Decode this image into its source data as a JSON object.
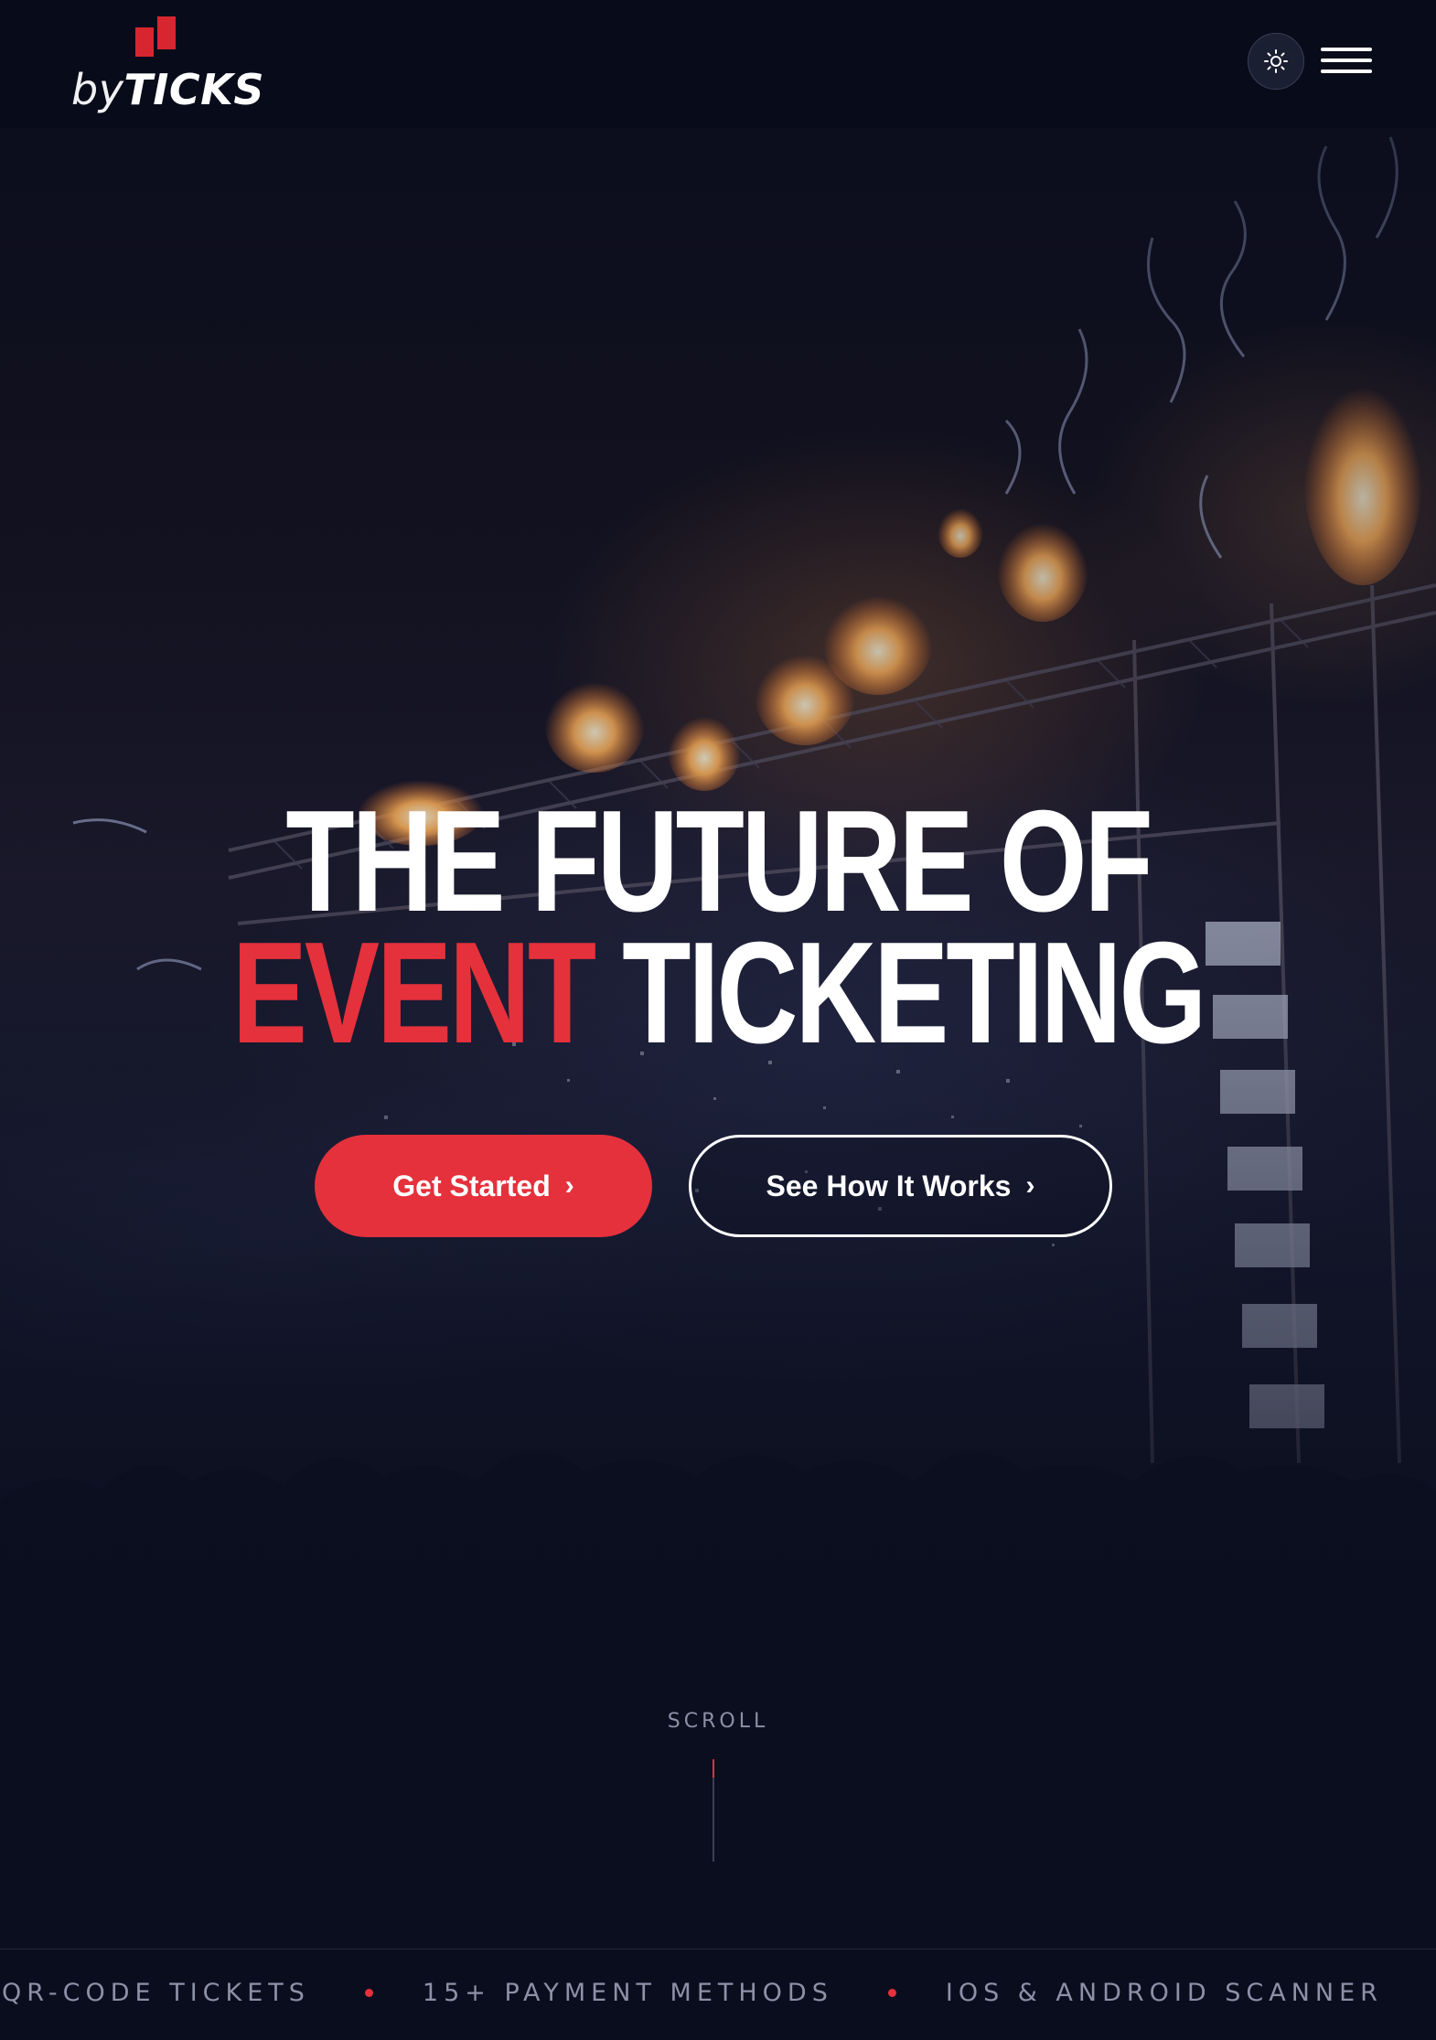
{
  "brand": {
    "logo_by": "by",
    "logo_ticks": "TICKS",
    "accent_color": "#e5313c",
    "background": "#0b0e1e"
  },
  "header": {
    "theme_toggle_icon": "sun-icon",
    "menu_icon": "hamburger-menu-icon"
  },
  "hero": {
    "headline_line1": "THE FUTURE OF",
    "headline_accent": "EVENT",
    "headline_rest": "TICKETING",
    "primary_cta": "Get Started",
    "secondary_cta": "See How It Works",
    "cta_chevron": "›"
  },
  "scroll": {
    "label": "SCROLL"
  },
  "ticker": {
    "items": [
      "QR-CODE TICKETS",
      "15+ PAYMENT METHODS",
      "IOS & ANDROID SCANNER"
    ]
  }
}
